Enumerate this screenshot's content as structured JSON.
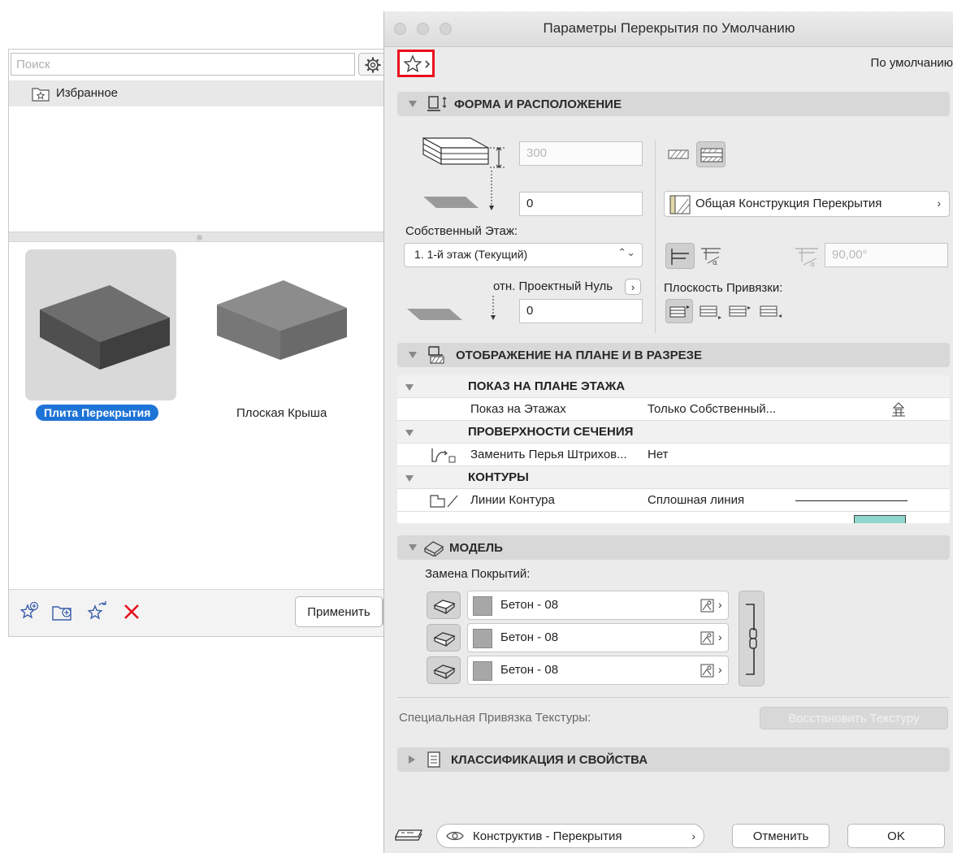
{
  "favorites": {
    "search_placeholder": "Поиск",
    "folder_label": "Избранное",
    "items": [
      {
        "label": "Плита Перекрытия",
        "selected": true
      },
      {
        "label": "Плоская Крыша",
        "selected": false
      }
    ],
    "apply_label": "Применить",
    "accent_color": "#1e73d6",
    "delete_color": "#e8101c"
  },
  "dialog": {
    "title": "Параметры Перекрытия по Умолчанию",
    "default_label": "По умолчанию",
    "sections": {
      "geometry": {
        "title": "ФОРМА И РАСПОЛОЖЕНИЕ",
        "thickness": "300",
        "offset_top": "0",
        "home_story_label": "Собственный Этаж:",
        "home_story_value": "1. 1-й этаж (Текущий)",
        "reference_label": "отн. Проектный Нуль",
        "offset_bottom": "0",
        "structure_value": "Общая Конструкция Перекрытия",
        "angle_value": "90,00°",
        "reference_plane_label": "Плоскость Привязки:"
      },
      "display": {
        "title": "ОТОБРАЖЕНИЕ НА ПЛАНЕ И В РАЗРЕЗЕ",
        "rows": [
          {
            "type": "group",
            "label": "ПОКАЗ НА ПЛАНЕ ЭТАЖА"
          },
          {
            "type": "item",
            "label": "Показ на Этажах",
            "value": "Только Собственный..."
          },
          {
            "type": "group",
            "label": "ПРОВЕРХНОСТИ СЕЧЕНИЯ"
          },
          {
            "type": "item",
            "label": "Заменить Перья Штрихов...",
            "value": "Нет"
          },
          {
            "type": "group",
            "label": "КОНТУРЫ"
          },
          {
            "type": "item",
            "label": "Линии Контура",
            "value": "Сплошная линия"
          }
        ]
      },
      "model": {
        "title": "МОДЕЛЬ",
        "override_label": "Замена Покрытий:",
        "surfaces": [
          "Бетон - 08",
          "Бетон - 08",
          "Бетон - 08"
        ],
        "texture_label": "Специальная Привязка Текстуры:",
        "reset_texture_label": "Восстановить Текстуру"
      },
      "classification": {
        "title": "КЛАССИФИКАЦИЯ И СВОЙСТВА"
      }
    },
    "footer": {
      "layer_value": "Конструктив - Перекрытия",
      "cancel_label": "Отменить",
      "ok_label": "OK"
    },
    "highlight_color": "#e8101c",
    "accent_teal": "#8fd6cf"
  }
}
